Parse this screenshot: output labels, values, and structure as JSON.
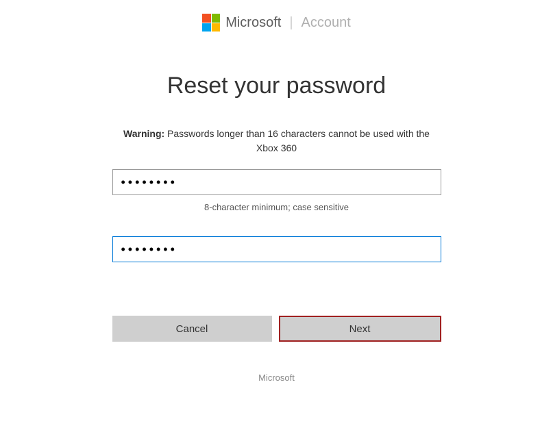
{
  "header": {
    "brand": "Microsoft",
    "section": "Account"
  },
  "main": {
    "title": "Reset your password",
    "warning_label": "Warning:",
    "warning_text": " Passwords longer than 16 characters cannot be used with the Xbox 360",
    "password1_value": "••••••••",
    "password2_value": "••••••••",
    "hint": "8-character minimum; case sensitive"
  },
  "buttons": {
    "cancel": "Cancel",
    "next": "Next"
  },
  "footer": {
    "text": "Microsoft"
  }
}
